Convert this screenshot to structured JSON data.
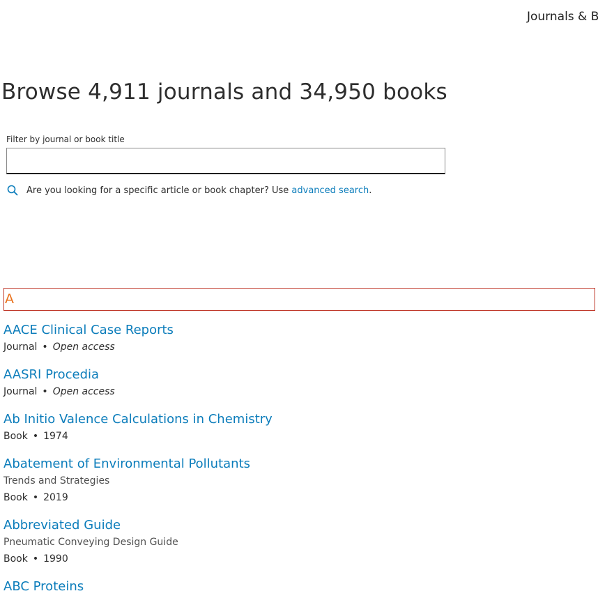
{
  "nav": {
    "journals_books": "Journals & B"
  },
  "page": {
    "title": "Browse 4,911 journals and 34,950 books"
  },
  "filter": {
    "label": "Filter by journal or book title",
    "placeholder": "",
    "value": ""
  },
  "hint": {
    "text": "Are you looking for a specific article or book chapter? Use ",
    "link": "advanced search",
    "end": "."
  },
  "letter": "A",
  "items": [
    {
      "title": "AACE Clinical Case Reports",
      "subtitle": "",
      "type": "Journal",
      "info": "Open access"
    },
    {
      "title": "AASRI Procedia",
      "subtitle": "",
      "type": "Journal",
      "info": "Open access"
    },
    {
      "title": "Ab Initio Valence Calculations in Chemistry",
      "subtitle": "",
      "type": "Book",
      "info": "1974"
    },
    {
      "title": "Abatement of Environmental Pollutants",
      "subtitle": "Trends and Strategies",
      "type": "Book",
      "info": "2019"
    },
    {
      "title": "Abbreviated Guide",
      "subtitle": "Pneumatic Conveying Design Guide",
      "type": "Book",
      "info": "1990"
    },
    {
      "title": "ABC Proteins",
      "subtitle": "",
      "type": "",
      "info": ""
    }
  ],
  "colors": {
    "link": "#0c7dbb",
    "letter": "#e9711c",
    "letter_border": "#c0392b"
  },
  "icons": {
    "search": "search-icon"
  }
}
